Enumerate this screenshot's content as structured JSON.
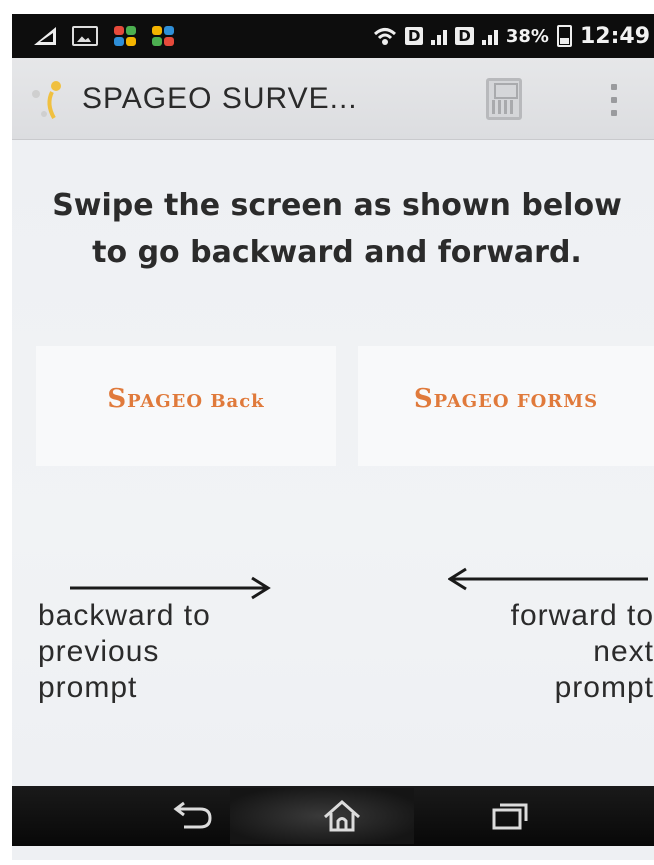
{
  "status_bar": {
    "battery_percent": "38%",
    "time": "12:49",
    "data_badge": "D",
    "icons": [
      "signal-icon",
      "image-icon",
      "app-dots-icon",
      "app-dots-icon",
      "wifi-icon",
      "mobile-data-icon",
      "signal-bars-icon",
      "battery-icon"
    ]
  },
  "action_bar": {
    "title": "SPAGEO SURVE...",
    "app_icon": "app-logo-icon",
    "save_icon": "save-icon",
    "overflow_icon": "overflow-menu-icon"
  },
  "content": {
    "instruction": "Swipe the screen as shown below to go backward and forward.",
    "back_panel": {
      "caption_initial": "S",
      "caption_rest": "PAGEO Back",
      "hint": [
        "backward to",
        "previous",
        "prompt"
      ]
    },
    "forward_panel": {
      "caption_initial": "S",
      "caption_rest": "PAGEO FORMS",
      "hint": [
        "forward to",
        "next",
        "prompt"
      ]
    }
  },
  "nav_bar": {
    "icons": [
      "back-icon",
      "home-icon",
      "recent-apps-icon"
    ]
  },
  "colors": {
    "status_bar": "#0d0d0d",
    "action_bar": "#e2e3e5",
    "content_bg": "#eef0f3",
    "caption_accent": "#e07a3b",
    "nav_bar": "#0f0f0f"
  }
}
